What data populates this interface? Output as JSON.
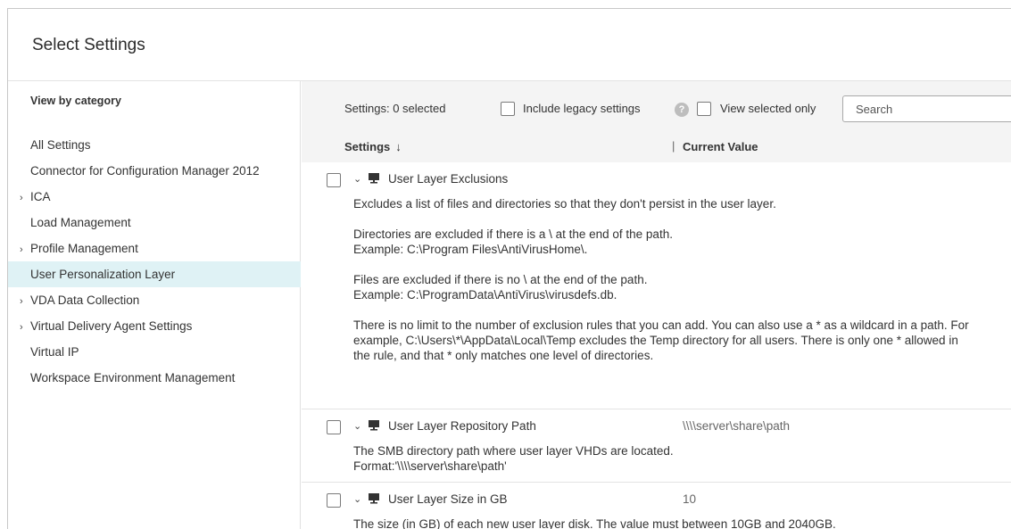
{
  "header": {
    "title": "Select Settings"
  },
  "sidebar": {
    "heading": "View by category",
    "items": [
      {
        "label": "All Settings",
        "expandable": false
      },
      {
        "label": "Connector for Configuration Manager 2012",
        "expandable": false
      },
      {
        "label": "ICA",
        "expandable": true
      },
      {
        "label": "Load Management",
        "expandable": false
      },
      {
        "label": "Profile Management",
        "expandable": true
      },
      {
        "label": "User Personalization Layer",
        "expandable": false,
        "selected": true
      },
      {
        "label": "VDA Data Collection",
        "expandable": true
      },
      {
        "label": "Virtual Delivery Agent Settings",
        "expandable": true
      },
      {
        "label": "Virtual IP",
        "expandable": false
      },
      {
        "label": "Workspace Environment Management",
        "expandable": false
      }
    ]
  },
  "toolbar": {
    "selected_count": "Settings: 0 selected",
    "include_legacy_label": "Include legacy settings",
    "help_icon": "?",
    "view_selected_label": "View selected only",
    "search_placeholder": "Search"
  },
  "table": {
    "col_settings": "Settings",
    "col_sort_icon": "↓",
    "col_separator": "|",
    "col_value": "Current Value",
    "rows": [
      {
        "name": "User Layer Exclusions",
        "value": "",
        "description": [
          "Excludes a list of files and directories so that they don't persist in the user layer.",
          "Directories are excluded if there is a \\ at the end of the path.\nExample: C:\\Program Files\\AntiVirusHome\\.",
          "Files are excluded if there is no \\ at the end of the path.\nExample: C:\\ProgramData\\AntiVirus\\virusdefs.db.",
          "There is no limit to the number of exclusion rules that you can add. You can also use a * as a wildcard in a path. For example, C:\\Users\\*\\AppData\\Local\\Temp excludes the Temp directory for all users. There is only one * allowed in the rule, and that * only matches one level of directories."
        ]
      },
      {
        "name": "User Layer Repository Path",
        "value": "\\\\\\\\server\\share\\path",
        "description": [
          "The SMB directory path where user layer VHDs are located.\nFormat:'\\\\\\\\server\\share\\path'"
        ]
      },
      {
        "name": "User Layer Size in GB",
        "value": "10",
        "description": [
          "The size (in GB) of each new user layer disk. The value must between 10GB and 2040GB."
        ]
      }
    ]
  },
  "colors": {
    "selected_bg": "#dff2f5",
    "toolbar_bg": "#f4f4f4",
    "help_icon_bg": "#bdbdbd"
  },
  "icons": {
    "expand_collapsed": "chevron-right-icon",
    "expand_open": "chevron-down-icon",
    "setting_type": "monitor-icon",
    "sort": "sort-down-icon",
    "help": "help-icon"
  }
}
